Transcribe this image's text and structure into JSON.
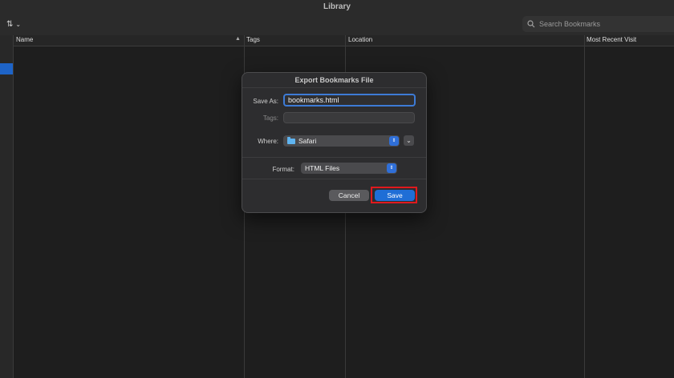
{
  "window": {
    "title": "Library"
  },
  "toolbar": {
    "sort_icon": "sort-arrows-icon",
    "chevron": "chevron-down-icon"
  },
  "search": {
    "placeholder": "Search Bookmarks"
  },
  "columns": [
    "Name",
    "Tags",
    "Location",
    "Most Recent Visit"
  ],
  "dialog": {
    "title": "Export Bookmarks File",
    "save_as_label": "Save As:",
    "save_as_value": "bookmarks.html",
    "tags_label": "Tags:",
    "tags_value": "",
    "where_label": "Where:",
    "where_value": "Safari",
    "format_label": "Format:",
    "format_value": "HTML Files",
    "cancel_label": "Cancel",
    "save_label": "Save"
  },
  "colors": {
    "accent": "#1f6ed6",
    "highlight": "#e0191e",
    "folder": "#5fb4f0"
  }
}
